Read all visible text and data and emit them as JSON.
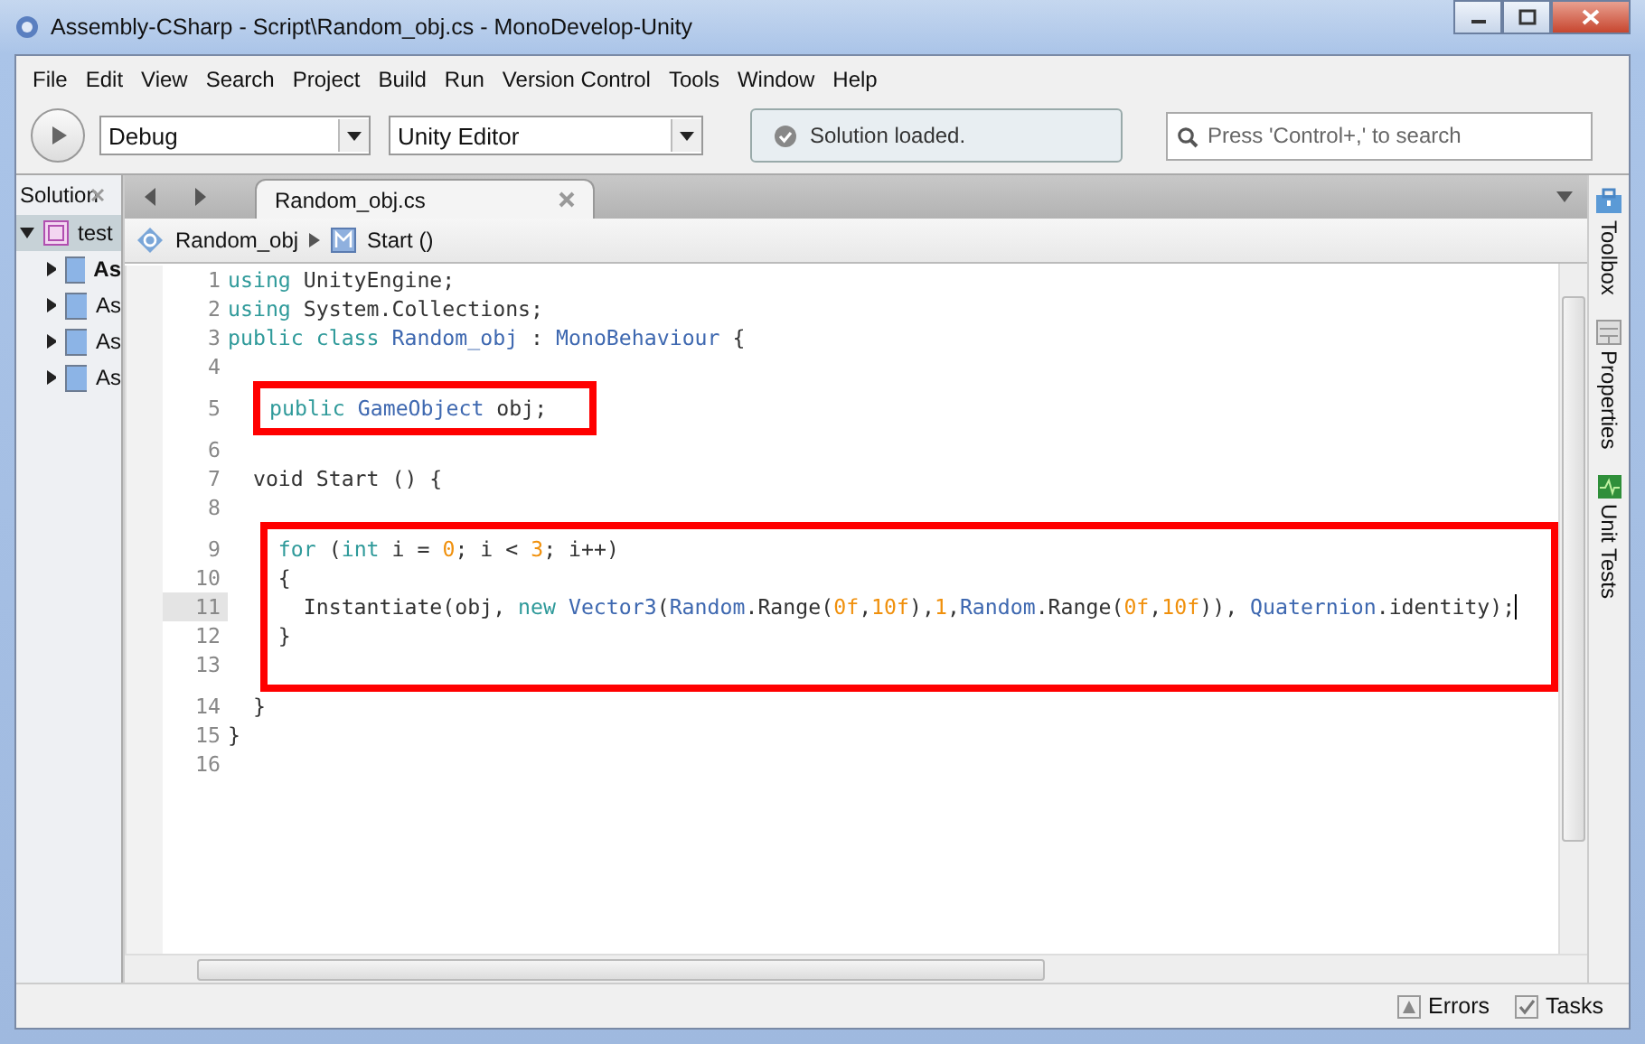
{
  "window": {
    "title": "Assembly-CSharp - Script\\Random_obj.cs - MonoDevelop-Unity"
  },
  "menu": [
    "File",
    "Edit",
    "View",
    "Search",
    "Project",
    "Build",
    "Run",
    "Version Control",
    "Tools",
    "Window",
    "Help"
  ],
  "toolbar": {
    "configuration": "Debug",
    "target": "Unity Editor",
    "status": "Solution loaded.",
    "search": {
      "placeholder": "Press 'Control+,' to search"
    }
  },
  "solution_pad": {
    "title": "Solution",
    "tree": [
      {
        "label": "test",
        "expanded": true,
        "selected": true,
        "children": [
          {
            "label": "As",
            "expanded": false,
            "selected": false,
            "startup": true
          },
          {
            "label": "As",
            "expanded": false,
            "selected": false,
            "startup": false
          },
          {
            "label": "As",
            "expanded": false,
            "selected": false,
            "startup": false
          },
          {
            "label": "As",
            "expanded": false,
            "selected": false,
            "startup": false
          }
        ]
      }
    ]
  },
  "tabs": [
    {
      "label": "Random_obj.cs",
      "selected": true
    }
  ],
  "breadcrumb": {
    "class": "Random_obj",
    "method": "Start ()"
  },
  "code": [
    {
      "boxed": false,
      "lines": [
        {
          "number": "1",
          "current": false,
          "tokens": [
            {
              "kind": "kw",
              "text": "using"
            },
            {
              "kind": "plain",
              "text": " UnityEngine;"
            }
          ]
        },
        {
          "number": "2",
          "current": false,
          "tokens": [
            {
              "kind": "kw",
              "text": "using"
            },
            {
              "kind": "plain",
              "text": " System.Collections;"
            }
          ]
        },
        {
          "number": "3",
          "current": false,
          "tokens": [
            {
              "kind": "kw",
              "text": "public class "
            },
            {
              "kind": "type",
              "text": "Random_obj"
            },
            {
              "kind": "plain",
              "text": " : "
            },
            {
              "kind": "type",
              "text": "MonoBehaviour"
            },
            {
              "kind": "plain",
              "text": " {"
            }
          ]
        },
        {
          "number": "4",
          "current": false
        }
      ]
    },
    {
      "boxed": true,
      "kind": "tight",
      "lines": [
        {
          "number": "5",
          "current": false,
          "tokens": [
            {
              "kind": "kw",
              "text": "public "
            },
            {
              "kind": "type",
              "text": "GameObject"
            },
            {
              "kind": "plain",
              "text": " obj;"
            }
          ]
        }
      ]
    },
    {
      "boxed": false,
      "lines": [
        {
          "number": "6",
          "current": false
        },
        {
          "number": "7",
          "current": false,
          "tokens": [
            {
              "kind": "plain",
              "text": "  void Start () {"
            }
          ]
        },
        {
          "number": "8",
          "current": false
        }
      ]
    },
    {
      "boxed": true,
      "kind": "wide",
      "lines": [
        {
          "number": "9",
          "current": false,
          "tokens": [
            {
              "kind": "kw",
              "text": "    for"
            },
            {
              "kind": "plain",
              "text": " ("
            },
            {
              "kind": "kw",
              "text": "int"
            },
            {
              "kind": "plain",
              "text": " i = "
            },
            {
              "kind": "num",
              "text": "0"
            },
            {
              "kind": "plain",
              "text": "; i < "
            },
            {
              "kind": "num",
              "text": "3"
            },
            {
              "kind": "plain",
              "text": "; i++)"
            }
          ]
        },
        {
          "number": "10",
          "current": false,
          "tokens": [
            {
              "kind": "plain",
              "text": "    {"
            }
          ]
        },
        {
          "number": "11",
          "current": true,
          "tokens": [
            {
              "kind": "plain",
              "text": "      Instantiate(obj, "
            },
            {
              "kind": "kw",
              "text": "new "
            },
            {
              "kind": "type",
              "text": "Vector3"
            },
            {
              "kind": "plain",
              "text": "("
            },
            {
              "kind": "type",
              "text": "Random"
            },
            {
              "kind": "plain",
              "text": ".Range("
            },
            {
              "kind": "num",
              "text": "0f"
            },
            {
              "kind": "plain",
              "text": ","
            },
            {
              "kind": "num",
              "text": "10f"
            },
            {
              "kind": "plain",
              "text": "),"
            },
            {
              "kind": "num",
              "text": "1"
            },
            {
              "kind": "plain",
              "text": ","
            },
            {
              "kind": "type",
              "text": "Random"
            },
            {
              "kind": "plain",
              "text": ".Range("
            },
            {
              "kind": "num",
              "text": "0f"
            },
            {
              "kind": "plain",
              "text": ","
            },
            {
              "kind": "num",
              "text": "10f"
            },
            {
              "kind": "plain",
              "text": ")), "
            },
            {
              "kind": "type",
              "text": "Quaternion"
            },
            {
              "kind": "plain",
              "text": ".identity);"
            }
          ]
        },
        {
          "number": "12",
          "current": false,
          "tokens": [
            {
              "kind": "plain",
              "text": "    }"
            }
          ]
        },
        {
          "number": "13",
          "current": false
        }
      ]
    },
    {
      "boxed": false,
      "lines": [
        {
          "number": "14",
          "current": false,
          "tokens": [
            {
              "kind": "plain",
              "text": "  }"
            }
          ]
        },
        {
          "number": "15",
          "current": false,
          "tokens": [
            {
              "kind": "plain",
              "text": "}"
            }
          ]
        },
        {
          "number": "16",
          "current": false
        }
      ]
    }
  ],
  "side_pads": [
    {
      "label": "Toolbox",
      "kind": "toolbox"
    },
    {
      "label": "Properties",
      "kind": "properties"
    },
    {
      "label": "Unit Tests",
      "kind": "tests"
    }
  ],
  "status_bar": [
    {
      "label": "Errors",
      "kind": "errors"
    },
    {
      "label": "Tasks",
      "kind": "tasks"
    }
  ]
}
